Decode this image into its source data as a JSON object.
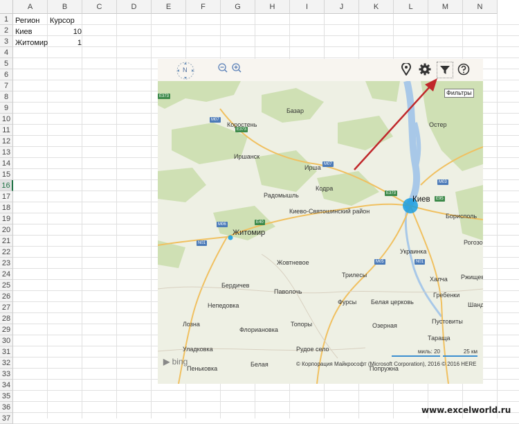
{
  "spreadsheet": {
    "columns": [
      "A",
      "B",
      "C",
      "D",
      "E",
      "F",
      "G",
      "H",
      "I",
      "J",
      "K",
      "L",
      "M",
      "N"
    ],
    "rows": [
      "1",
      "2",
      "3",
      "4",
      "5",
      "6",
      "7",
      "8",
      "9",
      "10",
      "11",
      "12",
      "13",
      "14",
      "15",
      "16",
      "17",
      "18",
      "19",
      "20",
      "21",
      "22",
      "23",
      "24",
      "25",
      "26",
      "27",
      "28",
      "29",
      "30",
      "31",
      "32",
      "33",
      "34",
      "35",
      "36",
      "37"
    ],
    "cells": {
      "a1": "Регион",
      "b1": "Курсор",
      "a2": "Киев",
      "b2": "10",
      "a3": "Житомир",
      "b3": "1"
    }
  },
  "map": {
    "nav_label": "N",
    "tooltip": "Фильтры",
    "cities": {
      "bazar": "Базар",
      "korosten": "Коростень",
      "irshansk": "Иршанск",
      "irsha": "Ирша",
      "kodra": "Кодра",
      "radomyshl": "Радомышль",
      "kiev": "Киев",
      "oster": "Остер",
      "kievsvyat": "Киево-Святошинский район",
      "zhytomyr": "Житомир",
      "borispol": "Борисполь",
      "ukrainka": "Украинка",
      "rogozov": "Рогозо",
      "zhovtnevoe": "Жовтневое",
      "trilesy": "Трилесы",
      "khalcha": "Халча",
      "rzhishchev": "Ржищев",
      "berdichev": "Бердичев",
      "pavolochi": "Паволочь",
      "nepedovka": "Непедовка",
      "fursy": "Фурсы",
      "belaya": "Белая церковь",
      "grebenki": "Гребенки",
      "shandra": "Шандра",
      "lozna": "Лозна",
      "floryanovka": "Флориановка",
      "topory": "Топоры",
      "ozernaya": "Озерная",
      "pustovity": "Пустовиты",
      "ruda": "Рудое село",
      "tarashcha": "Тараща",
      "uladkovka": "Уладковка",
      "belaya2": "Белая",
      "popruzhna": "Попружна",
      "penkovka": "Пеньковка"
    },
    "roads": {
      "m07a": "M07",
      "e373a": "E373",
      "e373b": "E373",
      "m07b": "M07",
      "e373c": "E373",
      "e40a": "E40",
      "m06": "M06",
      "n01": "N01",
      "m05": "M05",
      "n01b": "N01",
      "e95": "E95",
      "m03": "M03"
    },
    "bing": "bing",
    "scale_miles": "миль: 20",
    "scale_km": "25 км",
    "copyright": "© Корпорация Майкрософт (Microsoft Corporation), 2016     © 2016 HERE"
  },
  "watermark": "www.excelworld.ru"
}
